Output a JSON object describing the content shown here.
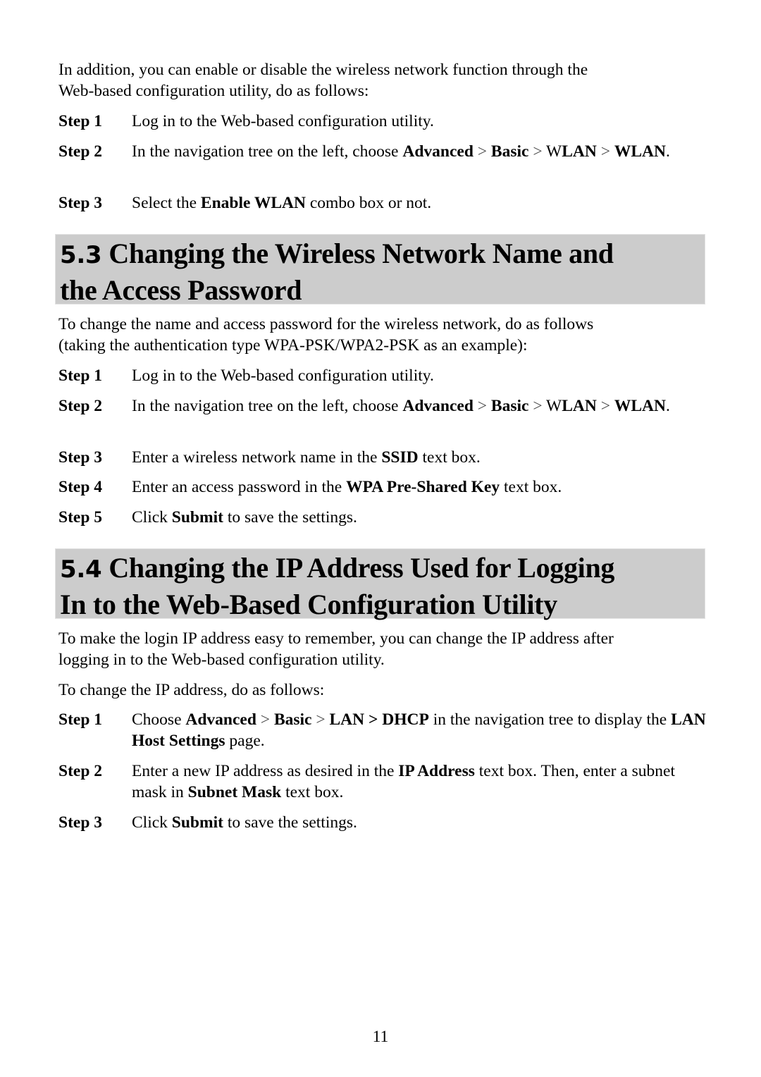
{
  "intro": {
    "line1": "In addition, you can enable or disable the wireless network function through the",
    "line2": "Web-based configuration utility, do as follows:"
  },
  "intro_steps": [
    {
      "label": "Step 1",
      "text": "Log in to the Web-based configuration utility."
    },
    {
      "label": "Step 2",
      "pre": "In the navigation tree on the left, choose ",
      "b1": "Advanced",
      "sep": " > ",
      "b2": "Basic",
      "w": "W",
      "b3": "LAN",
      "b4": "WLAN",
      "end": "."
    },
    {
      "label": "Step 3",
      "pre": "Select the ",
      "b1": "Enable WLAN",
      "post": " combo box or not."
    }
  ],
  "section_5_3": {
    "number": "5.3",
    "title_line1": "Changing the Wireless Network Name and",
    "title_line2": "the Access Password",
    "para_line1": "To change the name and access password for the wireless network, do as follows",
    "para_line2": "(taking the authentication type WPA-PSK/WPA2-PSK as an example):",
    "steps": [
      {
        "label": "Step 1",
        "text": "Log in to the Web-based configuration utility."
      },
      {
        "label": "Step 2",
        "pre": "In the navigation tree on the left, choose ",
        "b1": "Advanced",
        "sep": " > ",
        "b2": "Basic",
        "w": "W",
        "b3": "LAN",
        "b4": "WLAN",
        "end": "."
      },
      {
        "label": "Step 3",
        "pre": "Enter a wireless network name in the ",
        "b1": "SSID",
        "post": " text box."
      },
      {
        "label": "Step 4",
        "pre": "Enter an access password in the ",
        "b1": "WPA Pre-Shared Key",
        "post": " text box."
      },
      {
        "label": "Step 5",
        "pre": "Click ",
        "b1": "Submit",
        "post": " to save the settings."
      }
    ]
  },
  "section_5_4": {
    "number": "5.4",
    "title_line1": "Changing the IP Address Used for Logging",
    "title_line2": "In to the Web-Based Configuration Utility",
    "para1_line1": "To make the login IP address easy to remember, you can change the IP address after",
    "para1_line2": "logging in to the Web-based configuration utility.",
    "para2": "To change the IP address, do as follows:",
    "steps": [
      {
        "label": "Step 1",
        "pre": "Choose ",
        "b1": "Advanced",
        "sep": " > ",
        "b2": "Basic",
        "b3": "LAN > DHCP",
        "mid": " in the navigation tree to display the ",
        "b4": "LAN Host Settings",
        "post": " page."
      },
      {
        "label": "Step 2",
        "pre": "Enter a new IP address as desired in the ",
        "b1": "IP Address",
        "mid": " text box. Then, enter a subnet mask in ",
        "b2": "Subnet Mask",
        "post": " text box."
      },
      {
        "label": "Step 3",
        "pre": "Click ",
        "b1": "Submit",
        "post": " to save the settings."
      }
    ]
  },
  "page_number": "11"
}
